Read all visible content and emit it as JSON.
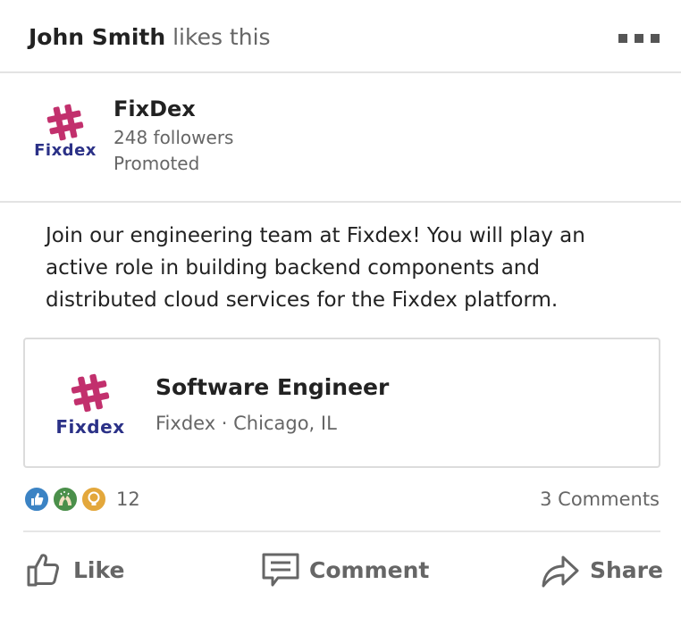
{
  "header": {
    "actor_name": "John Smith",
    "actor_suffix": " likes this",
    "more_icon": "more-horizontal-icon"
  },
  "company": {
    "logo_text": "Fixdex",
    "name": "FixDex",
    "followers": "248 followers",
    "promoted": "Promoted"
  },
  "post": {
    "text": "Join our engineering team at Fixdex! You will play an active role in building backend components and distributed cloud services for the Fixdex platform."
  },
  "job": {
    "logo_text": "Fixdex",
    "title": "Software Engineer",
    "subtitle": "Fixdex · Chicago, IL"
  },
  "social": {
    "reaction_count": "12",
    "comments": "3 Comments",
    "reaction_icons": [
      "like-reaction-icon",
      "celebrate-reaction-icon",
      "insightful-reaction-icon"
    ]
  },
  "actions": {
    "like": "Like",
    "comment": "Comment",
    "share": "Share"
  },
  "colors": {
    "brand_magenta": "#c2306d",
    "brand_navy": "#2b3187",
    "like_blue": "#3b83c4",
    "celebrate_green": "#4a8f4a",
    "insight_gold": "#e3a73b"
  }
}
